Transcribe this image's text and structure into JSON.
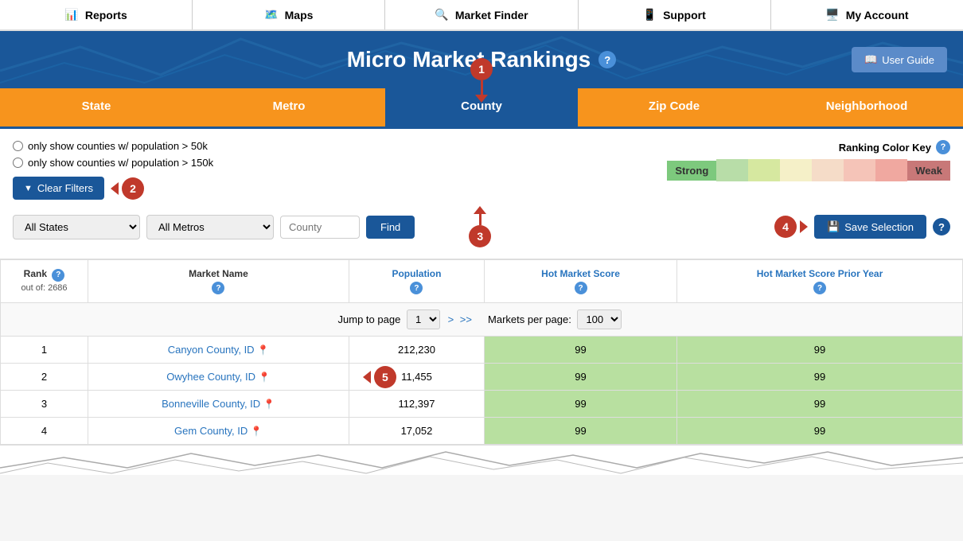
{
  "nav": {
    "items": [
      {
        "id": "reports",
        "label": "Reports",
        "icon": "chart-icon"
      },
      {
        "id": "maps",
        "label": "Maps",
        "icon": "map-icon"
      },
      {
        "id": "market-finder",
        "label": "Market Finder",
        "icon": "search-icon"
      },
      {
        "id": "support",
        "label": "Support",
        "icon": "phone-icon"
      },
      {
        "id": "my-account",
        "label": "My Account",
        "icon": "monitor-icon"
      }
    ]
  },
  "header": {
    "title": "Micro Market Rankings",
    "user_guide_label": "User Guide"
  },
  "tabs": [
    {
      "id": "state",
      "label": "State",
      "active": false
    },
    {
      "id": "metro",
      "label": "Metro",
      "active": false
    },
    {
      "id": "county",
      "label": "County",
      "active": true
    },
    {
      "id": "zipcode",
      "label": "Zip Code",
      "active": false
    },
    {
      "id": "neighborhood",
      "label": "Neighborhood",
      "active": false
    }
  ],
  "filters": {
    "radio1": "only show counties w/ population > 50k",
    "radio2": "only show counties w/ population > 150k",
    "clear_filters_label": "Clear Filters",
    "color_key_label": "Ranking Color Key",
    "color_key_strong": "Strong",
    "color_key_weak": "Weak",
    "state_dropdown_default": "All States",
    "metro_dropdown_default": "All Metros",
    "county_input_placeholder": "County",
    "find_label": "Find",
    "save_selection_label": "Save Selection"
  },
  "table": {
    "col_rank": "Rank",
    "col_rank_sub": "out of: 2686",
    "col_market": "Market Name",
    "col_population": "Population",
    "col_hot_score": "Hot Market Score",
    "col_hot_score_prior": "Hot Market Score Prior Year",
    "pagination_jump_label": "Jump to page",
    "pagination_page": "1",
    "pagination_next": ">",
    "pagination_last": ">>",
    "pagination_per_page_label": "Markets per page:",
    "pagination_per_page": "100",
    "rows": [
      {
        "rank": 1,
        "name": "Canyon County, ID",
        "population": "212,230",
        "hot_score": 99,
        "hot_score_prior": 99
      },
      {
        "rank": 2,
        "name": "Owyhee County, ID",
        "population": "11,455",
        "hot_score": 99,
        "hot_score_prior": 99
      },
      {
        "rank": 3,
        "name": "Bonneville County, ID",
        "population": "112,397",
        "hot_score": 99,
        "hot_score_prior": 99
      },
      {
        "rank": 4,
        "name": "Gem County, ID",
        "population": "17,052",
        "hot_score": 99,
        "hot_score_prior": 99
      }
    ]
  },
  "annotations": {
    "a1": "1",
    "a2": "2",
    "a3": "3",
    "a4": "4",
    "a5": "5"
  }
}
